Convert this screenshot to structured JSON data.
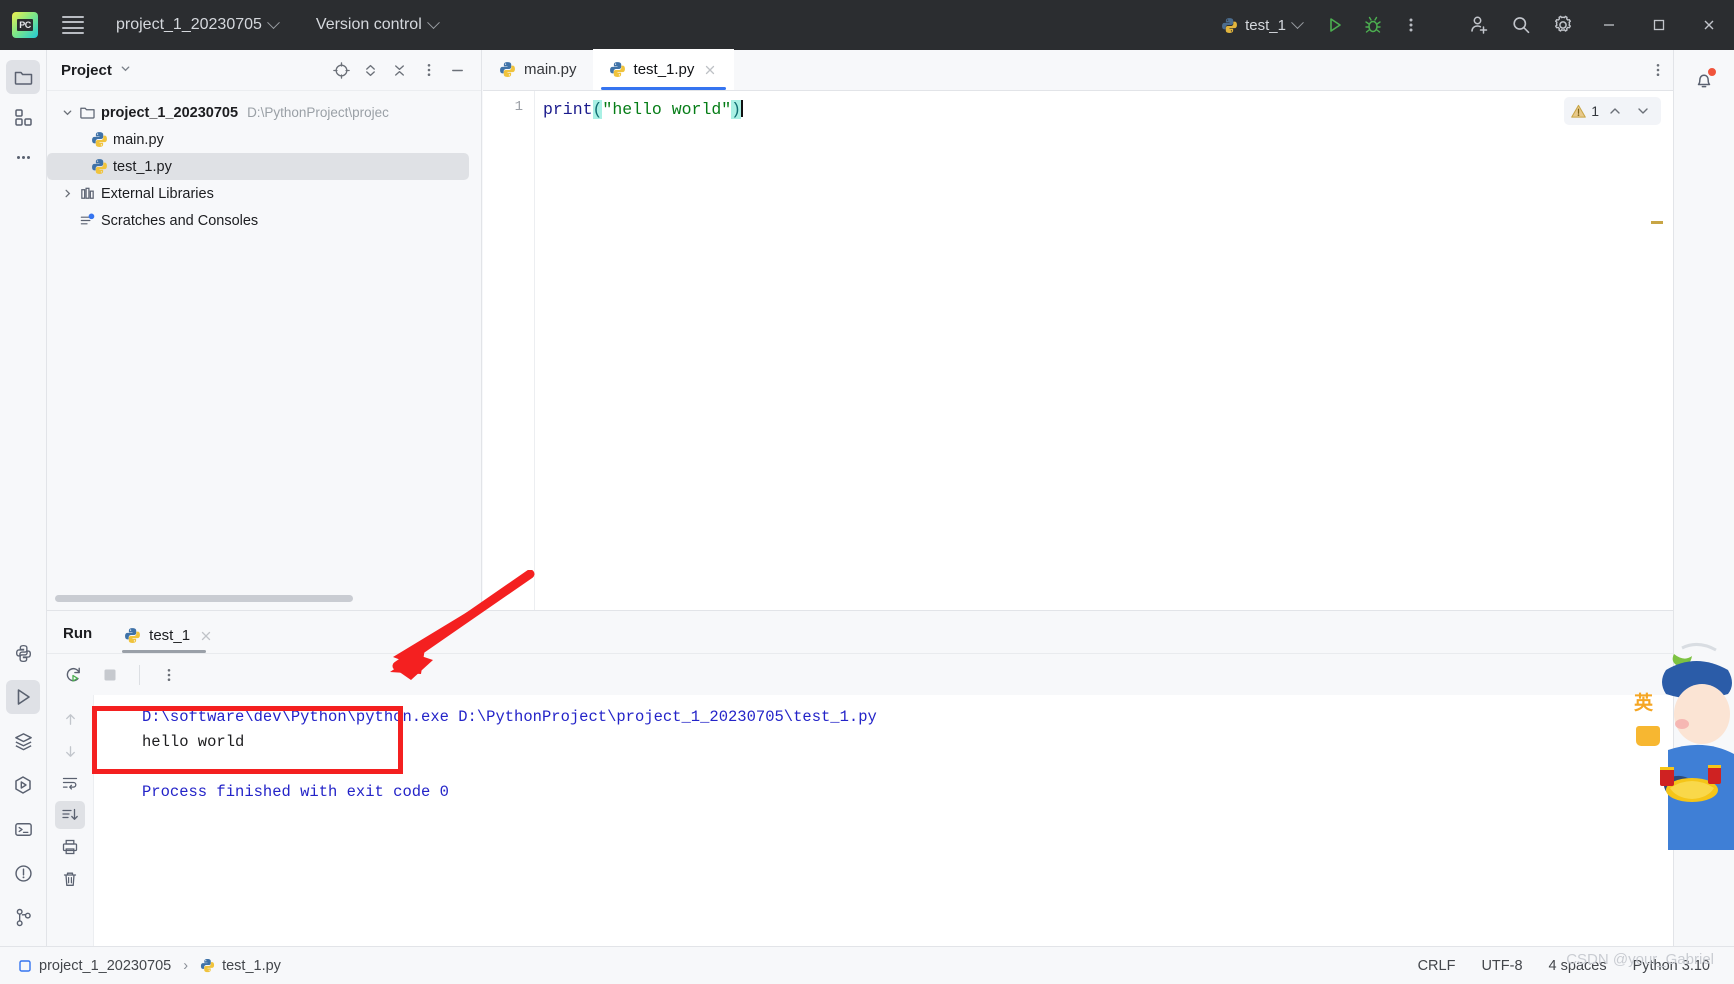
{
  "titlebar": {
    "logo_text": "PC",
    "project_name": "project_1_20230705",
    "vcs_label": "Version control",
    "run_config": "test_1",
    "icons": {
      "hamburger": "main-menu-icon",
      "python": "python-icon",
      "run": "run-icon",
      "debug": "debug-icon",
      "more": "more-vertical-icon",
      "share": "add-user-icon",
      "search": "search-icon",
      "settings": "gear-icon",
      "minimize": "minimize-icon",
      "maximize": "maximize-icon",
      "close": "close-icon"
    }
  },
  "rail": {
    "top": [
      {
        "name": "project-tool-window",
        "icon": "folder-icon",
        "active": true
      },
      {
        "name": "commit-tool-window",
        "icon": "structure-blocks-icon",
        "active": false
      },
      {
        "name": "more-tool-windows",
        "icon": "ellipsis-icon",
        "active": false
      }
    ],
    "bottom": [
      {
        "name": "python-console",
        "icon": "python-console-icon",
        "active": false
      },
      {
        "name": "run-tool-window",
        "icon": "run-triangle-icon",
        "active": true
      },
      {
        "name": "services-tool-window",
        "icon": "layers-icon",
        "active": false
      },
      {
        "name": "python-packages",
        "icon": "hex-play-icon",
        "active": false
      },
      {
        "name": "terminal-tool-window",
        "icon": "terminal-icon",
        "active": false
      },
      {
        "name": "problems-tool-window",
        "icon": "warning-circle-icon",
        "active": false
      },
      {
        "name": "version-control-window",
        "icon": "git-branch-icon",
        "active": false
      }
    ]
  },
  "project_panel": {
    "title": "Project",
    "actions": [
      {
        "name": "select-opened-file",
        "icon": "target-icon"
      },
      {
        "name": "expand-collapse",
        "icon": "updown-chevron-icon"
      },
      {
        "name": "collapse-all",
        "icon": "collapse-all-icon"
      },
      {
        "name": "options-menu",
        "icon": "more-vertical-icon"
      },
      {
        "name": "hide-panel",
        "icon": "minimize-line-icon"
      }
    ],
    "tree": [
      {
        "label": "project_1_20230705",
        "path": "D:\\PythonProject\\projec",
        "icon": "folder-icon",
        "indent": 0,
        "twisty": "open",
        "bold": true,
        "selected": false
      },
      {
        "label": "main.py",
        "path": "",
        "icon": "python-file-icon",
        "indent": 1,
        "twisty": "none",
        "bold": false,
        "selected": false
      },
      {
        "label": "test_1.py",
        "path": "",
        "icon": "python-file-icon",
        "indent": 1,
        "twisty": "none",
        "bold": false,
        "selected": true
      },
      {
        "label": "External Libraries",
        "path": "",
        "icon": "library-icon",
        "indent": 0,
        "twisty": "closed",
        "bold": false,
        "selected": false
      },
      {
        "label": "Scratches and Consoles",
        "path": "",
        "icon": "scratches-icon",
        "indent": 0,
        "twisty": "none",
        "bold": false,
        "selected": false
      }
    ]
  },
  "editor": {
    "tabs": [
      {
        "label": "main.py",
        "icon": "python-file-icon",
        "active": false,
        "closable": false
      },
      {
        "label": "test_1.py",
        "icon": "python-file-icon",
        "active": true,
        "closable": true
      }
    ],
    "line_number": "1",
    "code": {
      "fn": "print",
      "open_paren": "(",
      "string": "\"hello world\"",
      "close_paren": ")"
    },
    "inspection": {
      "icon": "warning-triangle-icon",
      "count": "1",
      "prev_icon": "chevron-up-icon",
      "next_icon": "chevron-down-icon"
    },
    "tabbar_options_icon": "more-vertical-icon"
  },
  "notifications": {
    "icon": "bell-icon",
    "has_unread": true
  },
  "run_panel": {
    "title": "Run",
    "tab": {
      "label": "test_1",
      "icon": "python-icon",
      "close_icon": "close-icon"
    },
    "toolbar": [
      {
        "name": "rerun-button",
        "icon": "rerun-icon"
      },
      {
        "name": "stop-button",
        "icon": "stop-square-icon"
      },
      {
        "name": "run-options",
        "icon": "more-vertical-icon"
      }
    ],
    "console_gutter": [
      {
        "name": "previous-occurrence",
        "icon": "arrow-up-icon",
        "active": false
      },
      {
        "name": "next-occurrence",
        "icon": "arrow-down-icon",
        "active": false
      },
      {
        "name": "soft-wrap",
        "icon": "soft-wrap-icon",
        "active": false
      },
      {
        "name": "scroll-to-end",
        "icon": "scroll-to-end-icon",
        "active": true
      },
      {
        "name": "print-console",
        "icon": "printer-icon",
        "active": false
      },
      {
        "name": "clear-console",
        "icon": "trash-icon",
        "active": false
      }
    ],
    "console_output": [
      {
        "text": "D:\\software\\dev\\Python\\python.exe D:\\PythonProject\\project_1_20230705\\test_1.py",
        "style": "blue"
      },
      {
        "text": "hello world",
        "style": "black"
      },
      {
        "text": "",
        "style": "blank"
      },
      {
        "text": "Process finished with exit code 0",
        "style": "blue"
      }
    ]
  },
  "statusbar": {
    "breadcrumb": [
      {
        "label": "project_1_20230705",
        "icon": "module-icon"
      },
      {
        "label": "test_1.py",
        "icon": "python-file-icon"
      }
    ],
    "separator": "›",
    "right_items": [
      "CRLF",
      "UTF-8",
      "4 spaces",
      "Python 3.10"
    ],
    "watermark": "CSDN @your_Gabriel"
  },
  "ime": {
    "mode_label": "英"
  },
  "colors": {
    "titlebar_bg": "#2b2d30",
    "accent_blue": "#3574f0",
    "panel_bg": "#f7f8fa",
    "editor_bg": "#ffffff",
    "string_green": "#067d17",
    "keyword_navy": "#1a1a8c",
    "annotation_red": "#f42020",
    "warning_amber": "#e8b339"
  }
}
